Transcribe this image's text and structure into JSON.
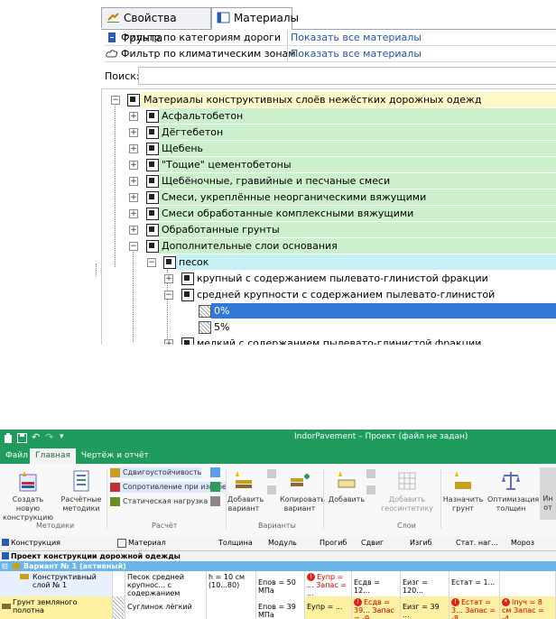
{
  "tabs": [
    {
      "label": "Свойства грунта"
    },
    {
      "label": "Материалы"
    }
  ],
  "filters": [
    {
      "label": "Фильтр по категориям дороги",
      "value": "Показать все материалы"
    },
    {
      "label": "Фильтр по климатическим зонам",
      "value": "Показать все материалы"
    }
  ],
  "search": {
    "label": "Поиск:",
    "value": ""
  },
  "tree": {
    "root": "Материалы конструктивных слоёв нежёстких дорожных одежд",
    "groups": [
      "Асфальтобетон",
      "Дёгтебетон",
      "Щебень",
      "\"Тощие\" цементобетоны",
      "Щебёночные, гравийные и песчаные смеси",
      "Смеси, укреплённые неорганическими вяжущими",
      "Смеси обработанные комплексными вяжущими",
      "Обработанные грунты",
      "Дополнительные слои основания"
    ],
    "sand": "песок",
    "sand_children": [
      "крупный с содержанием пылевато-глинистой фракции",
      "средней крупности с содержанием пылевато-глинистой",
      "мелкий с содержанием пылевато-глинистой фракции"
    ],
    "leaves": [
      "0%",
      "5%"
    ]
  },
  "app": {
    "title": "IndorPavement – Проект (файл не задан)",
    "menu": [
      "Файл",
      "Главная",
      "Чертёж и отчёт"
    ],
    "ribbon": {
      "new_construction": "Создать новую конструкцию",
      "calc_methods": "Расчётные методики",
      "shear": "Сдвигоустойчивость",
      "bend": "Сопротивление при изгибе",
      "static": "Статическая нагрузка",
      "add_variant": "Добавить вариант",
      "copy_variant": "Копировать вариант",
      "add": "Добавить",
      "add_geosynth": "Добавить геосинтетику",
      "assign_ground": "Назначить грунт",
      "optimize": "Оптимизация толщин",
      "more": "Ин от",
      "groups": [
        "Методики",
        "Расчёт",
        "Варианты",
        "Слои"
      ]
    },
    "columns": [
      "Конструкция",
      "Материал",
      "Толщина",
      "Модуль",
      "Прогиб",
      "Сдвиг",
      "Изгиб",
      "Стат. наг...",
      "Мороз"
    ],
    "project_row": "Проект конструкции дорожной одежды",
    "variant_row": "Вариант № 1 (активный)",
    "layer1": {
      "name": "Конструктивный слой № 1",
      "material": "Песок средней крупнос... с содержанием пылевато-глинистой",
      "thickness": "h = 10 см (10...80)",
      "modulus": "Eпов = 50 МПа",
      "deflection": "Eупр = ... Запас = ...",
      "shear": "Eсдв = 12...",
      "bend": "Eизг = 120...",
      "static": "Eстат = 1..."
    },
    "ground": {
      "name": "Грунт земляного полотна",
      "material": "Суглинок лёгкий",
      "modulus": "Eпов = 39 МПа",
      "deflection": "Eупр = ...",
      "shear": "Eсдв = 39... Запас = -9...",
      "bend": "Eизг = 39 ...",
      "static": "Eстат = 3... Запас = -8...",
      "frost": "lпуч = 8 см Запас = -4..."
    }
  },
  "colors": {
    "green": "#cdf0cc",
    "yellow": "#fdf8c8",
    "cyan": "#c6f1f4",
    "selection": "#3278d8",
    "titlebar": "#1f9b5e"
  }
}
